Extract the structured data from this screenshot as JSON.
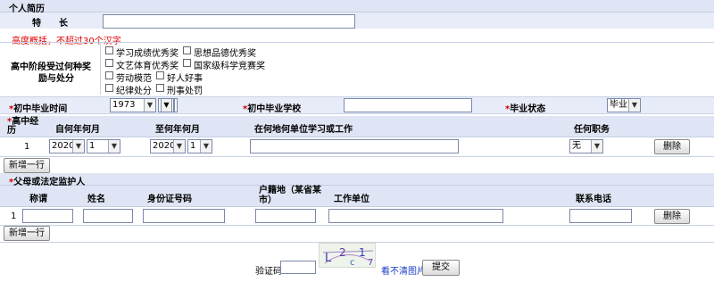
{
  "resume": {
    "section_title": "个人简历",
    "specialty_label": "特　　长",
    "specialty_value": "",
    "hint": "高度概括，不超过30个汉字",
    "awards_label_line1": "高中阶段受过何种奖",
    "awards_label_line2": "励与处分",
    "awards": [
      {
        "label": "学习成绩优秀奖"
      },
      {
        "label": "思想品德优秀奖"
      },
      {
        "label": "文艺体育优秀奖"
      },
      {
        "label": "国家级科学竞赛奖"
      },
      {
        "label": "劳动模范"
      },
      {
        "label": "好人好事"
      },
      {
        "label": "纪律处分"
      },
      {
        "label": "刑事处罚"
      }
    ]
  },
  "graduation": {
    "time_label": "*初中毕业时间",
    "year": "1973",
    "month": "1",
    "school_label": "*初中毕业学校",
    "school_value": "",
    "status_label": "*毕业状态",
    "status_value": "毕业"
  },
  "experience": {
    "header_star": "*",
    "header_label": "高中经历",
    "col_from": "自何年何月",
    "col_to": "至何年何月",
    "col_place": "在何地何单位学习或工作",
    "col_position": "任何职务",
    "rows": [
      {
        "index": "1",
        "from_year": "2020",
        "from_month": "1",
        "to_year": "2020",
        "to_month": "1",
        "place": "",
        "position": "无",
        "delete_label": "删除"
      }
    ],
    "add_label": "新增一行"
  },
  "guardians": {
    "section_title": "*父母或法定监护人",
    "col_title": "称谓",
    "col_name": "姓名",
    "col_id": "身份证号码",
    "col_household": "户籍地（某省某市）",
    "col_work": "工作单位",
    "col_phone": "联系电话",
    "rows": [
      {
        "index": "1",
        "title": "",
        "name": "",
        "id_number": "",
        "household": "",
        "work": "",
        "phone": "",
        "delete_label": "删除"
      }
    ],
    "add_label": "新增一行"
  },
  "captcha": {
    "label": "验证码",
    "value": "",
    "image_text": "L2c1",
    "refresh_label": "看不清图片",
    "submit_label": "提交"
  }
}
